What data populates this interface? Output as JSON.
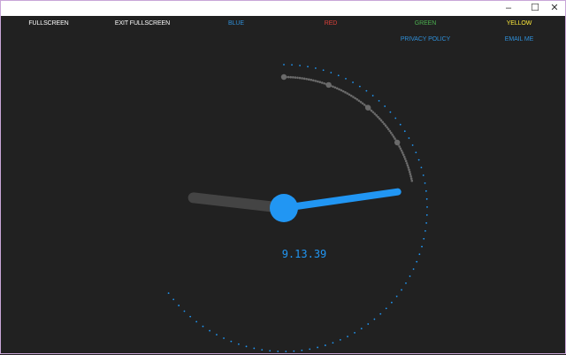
{
  "window": {
    "minimize": "–",
    "maximize": "☐",
    "close": "✕"
  },
  "nav": {
    "fullscreen": "FULLSCREEN",
    "exit_fullscreen": "EXIT FULLSCREEN",
    "blue": "BLUE",
    "red": "RED",
    "green": "GREEN",
    "yellow": "YELLOW",
    "privacy": "PRIVACY POLICY",
    "email": "EMAIL ME"
  },
  "clock": {
    "time_text": "9.13.39",
    "hours": 9,
    "minutes": 13,
    "seconds": 39,
    "accent": "#2196f3",
    "track": "#6a6a6a",
    "hour_hand": "#444444"
  },
  "colors": {
    "blue": "#2f8fd8",
    "red": "#d9413a",
    "green": "#4caf50",
    "yellow": "#ffeb3b",
    "white": "#ffffff"
  }
}
